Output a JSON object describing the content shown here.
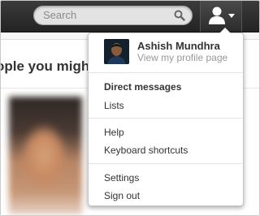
{
  "search": {
    "placeholder": "Search"
  },
  "main": {
    "section_title": "ople you migh"
  },
  "user_menu": {
    "profile_name": "Ashish Mundhra",
    "profile_sub": "View my profile page",
    "items": [
      {
        "label": "Direct messages",
        "bold": true
      },
      {
        "label": "Lists",
        "bold": false
      },
      {
        "label": "Help",
        "bold": false
      },
      {
        "label": "Keyboard shortcuts",
        "bold": false
      },
      {
        "label": "Settings",
        "bold": false
      },
      {
        "label": "Sign out",
        "bold": false
      }
    ]
  },
  "icons": {
    "search": "search-icon",
    "user": "user-icon",
    "caret": "caret-down-icon"
  },
  "colors": {
    "topbar": "#2c2c2c",
    "menu_bg": "#ffffff",
    "text": "#333333",
    "muted": "#999999"
  }
}
